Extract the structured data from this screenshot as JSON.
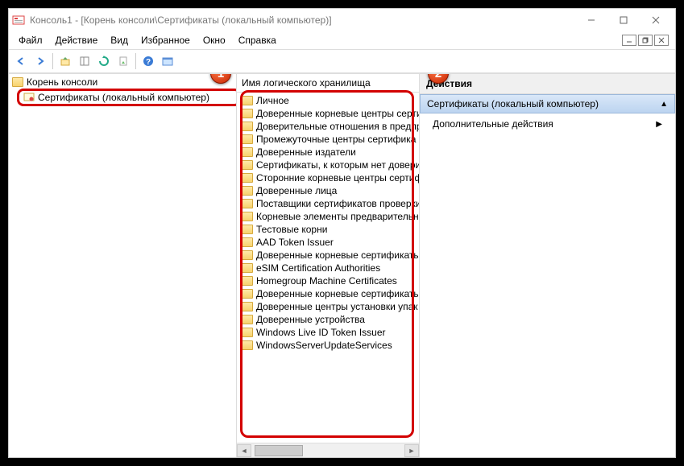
{
  "title": "Консоль1 - [Корень консоли\\Сертификаты (локальный компьютер)]",
  "menu": {
    "file": "Файл",
    "action": "Действие",
    "view": "Вид",
    "favorites": "Избранное",
    "window": "Окно",
    "help": "Справка"
  },
  "tree": {
    "root": "Корень консоли",
    "node": "Сертификаты (локальный компьютер)"
  },
  "list": {
    "header": "Имя логического хранилища",
    "items": [
      "Личное",
      "Доверенные корневые центры серти",
      "Доверительные отношения в предпр",
      "Промежуточные центры сертифика",
      "Доверенные издатели",
      "Сертификаты, к которым нет довери",
      "Сторонние корневые центры сертиф",
      "Доверенные лица",
      "Поставщики сертификатов проверки",
      "Корневые элементы предварительно",
      "Тестовые корни",
      "AAD Token Issuer",
      "Доверенные корневые сертификаты",
      "eSIM Certification Authorities",
      "Homegroup Machine Certificates",
      "Доверенные корневые сертификаты",
      "Доверенные центры установки упак",
      "Доверенные устройства",
      "Windows Live ID Token Issuer",
      "WindowsServerUpdateServices"
    ]
  },
  "actions": {
    "header": "Действия",
    "selected": "Сертификаты (локальный компьютер)",
    "more": "Дополнительные действия"
  },
  "badges": {
    "one": "1",
    "two": "2"
  }
}
